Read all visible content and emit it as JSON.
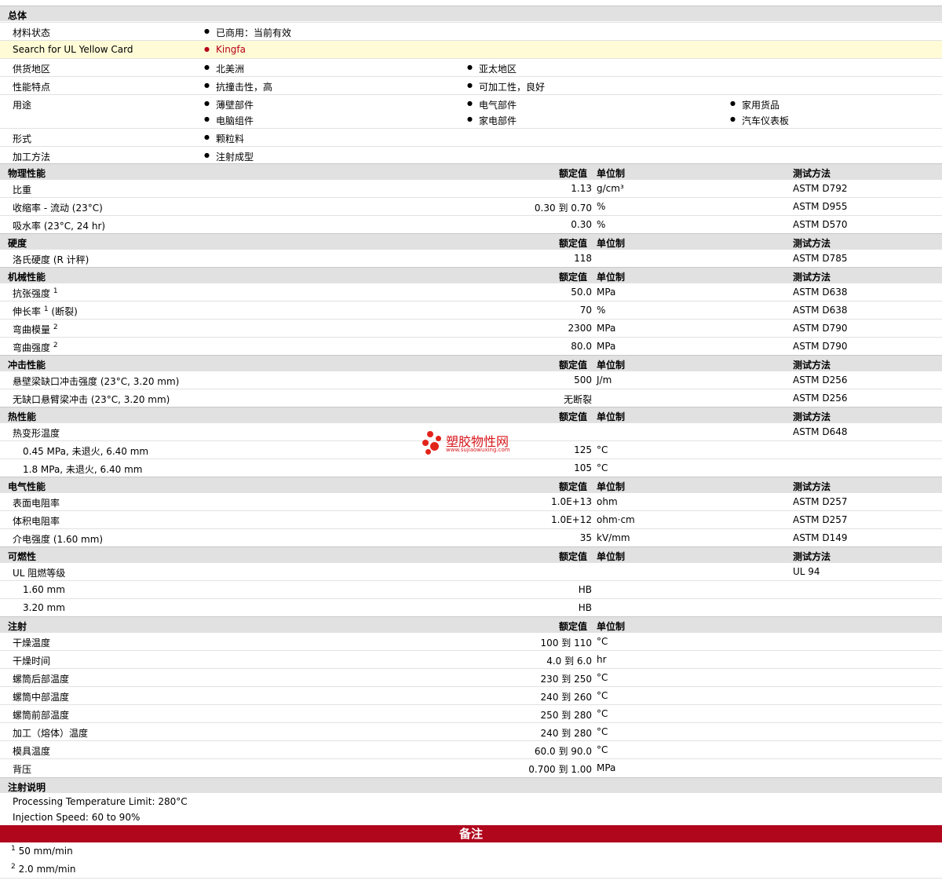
{
  "general": {
    "title": "总体",
    "status_label": "材料状态",
    "status_value": "已商用：当前有效",
    "ul_label": "Search for UL Yellow Card",
    "ul_value": "Kingfa",
    "region_label": "供货地区",
    "region_1": "北美洲",
    "region_2": "亚太地区",
    "features_label": "性能特点",
    "feature_1": "抗撞击性，高",
    "feature_2": "可加工性，良好",
    "uses_label": "用途",
    "use_1": "薄壁部件",
    "use_2": "电气部件",
    "use_3": "家用货品",
    "use_4": "电脑组件",
    "use_5": "家电部件",
    "use_6": "汽车仪表板",
    "form_label": "形式",
    "form_value": "颗粒料",
    "process_label": "加工方法",
    "process_value": "注射成型"
  },
  "headers": {
    "nominal": "额定值",
    "unit": "单位制",
    "method": "测试方法"
  },
  "physical": {
    "title": "物理性能",
    "r1": {
      "label": "比重",
      "value": "1.13",
      "unit": "g/cm³",
      "method": "ASTM D792"
    },
    "r2": {
      "label": "收缩率 - 流动 (23°C)",
      "value": "0.30 到  0.70",
      "unit": "%",
      "method": "ASTM D955"
    },
    "r3": {
      "label": "吸水率 (23°C, 24 hr)",
      "value": "0.30",
      "unit": "%",
      "method": "ASTM D570"
    }
  },
  "hardness": {
    "title": "硬度",
    "r1": {
      "label": "洛氏硬度 (R 计秤)",
      "value": "118",
      "unit": "",
      "method": "ASTM D785"
    }
  },
  "mechanical": {
    "title": "机械性能",
    "r1": {
      "label": "抗张强度",
      "sup": "1",
      "suffix": "",
      "value": "50.0",
      "unit": "MPa",
      "method": "ASTM D638"
    },
    "r2": {
      "label": "伸长率",
      "sup": "1",
      "suffix": " (断裂)",
      "value": "70",
      "unit": "%",
      "method": "ASTM D638"
    },
    "r3": {
      "label": "弯曲模量",
      "sup": "2",
      "suffix": "",
      "value": "2300",
      "unit": "MPa",
      "method": "ASTM D790"
    },
    "r4": {
      "label": "弯曲强度",
      "sup": "2",
      "suffix": "",
      "value": "80.0",
      "unit": "MPa",
      "method": "ASTM D790"
    }
  },
  "impact": {
    "title": "冲击性能",
    "r1": {
      "label": "悬壁梁缺口冲击强度 (23°C, 3.20 mm)",
      "value": "500",
      "unit": "J/m",
      "method": "ASTM D256"
    },
    "r2": {
      "label": "无缺口悬臂梁冲击 (23°C, 3.20 mm)",
      "value": "无断裂",
      "unit": "",
      "method": "ASTM D256"
    }
  },
  "thermal": {
    "title": "热性能",
    "r1": {
      "label": "热变形温度",
      "value": "",
      "unit": "",
      "method": "ASTM D648"
    },
    "r2": {
      "label": "0.45 MPa, 未退火, 6.40 mm",
      "value": "125",
      "unit": "°C",
      "method": ""
    },
    "r3": {
      "label": "1.8 MPa, 未退火, 6.40 mm",
      "value": "105",
      "unit": "°C",
      "method": ""
    }
  },
  "electrical": {
    "title": "电气性能",
    "r1": {
      "label": "表面电阻率",
      "value": "1.0E+13",
      "unit": "ohm",
      "method": "ASTM D257"
    },
    "r2": {
      "label": "体积电阻率",
      "value": "1.0E+12",
      "unit": "ohm·cm",
      "method": "ASTM D257"
    },
    "r3": {
      "label": "介电强度 (1.60 mm)",
      "value": "35",
      "unit": "kV/mm",
      "method": "ASTM D149"
    }
  },
  "flammability": {
    "title": "可燃性",
    "r1": {
      "label": "UL 阻燃等级",
      "value": "",
      "unit": "",
      "method": "UL 94"
    },
    "r2": {
      "label": "1.60 mm",
      "value": "HB",
      "unit": "",
      "method": ""
    },
    "r3": {
      "label": "3.20 mm",
      "value": "HB",
      "unit": "",
      "method": ""
    }
  },
  "injection": {
    "title": "注射",
    "r1": {
      "label": "干燥温度",
      "value": "100 到  110",
      "unit": "°C"
    },
    "r2": {
      "label": "干燥时间",
      "value": "4.0 到  6.0",
      "unit": "hr"
    },
    "r3": {
      "label": "螺筒后部温度",
      "value": "230 到  250",
      "unit": "°C"
    },
    "r4": {
      "label": "螺筒中部温度",
      "value": "240 到  260",
      "unit": "°C"
    },
    "r5": {
      "label": "螺筒前部温度",
      "value": "250 到  280",
      "unit": "°C"
    },
    "r6": {
      "label": "加工（熔体）温度",
      "value": "240 到  280",
      "unit": "°C"
    },
    "r7": {
      "label": "模具温度",
      "value": "60.0 到  90.0",
      "unit": "°C"
    },
    "r8": {
      "label": "背压",
      "value": "0.700 到  1.00",
      "unit": "MPa"
    }
  },
  "injection_notes": {
    "title": "注射说明",
    "line1": "Processing Temperature Limit: 280°C",
    "line2": "Injection Speed: 60 to 90%"
  },
  "remarks": {
    "title": "备注",
    "n1_sup": "1",
    "n1": "50 mm/min",
    "n2_sup": "2",
    "n2": "2.0 mm/min"
  },
  "watermark": {
    "brand": "塑胶物性网",
    "url": "www.sujiaowuxing.com"
  },
  "colors": {
    "section_bg": "#e1e1e1",
    "highlight_bg": "#fffbd6",
    "banner_bg": "#b0071d",
    "link": "#b40016"
  }
}
